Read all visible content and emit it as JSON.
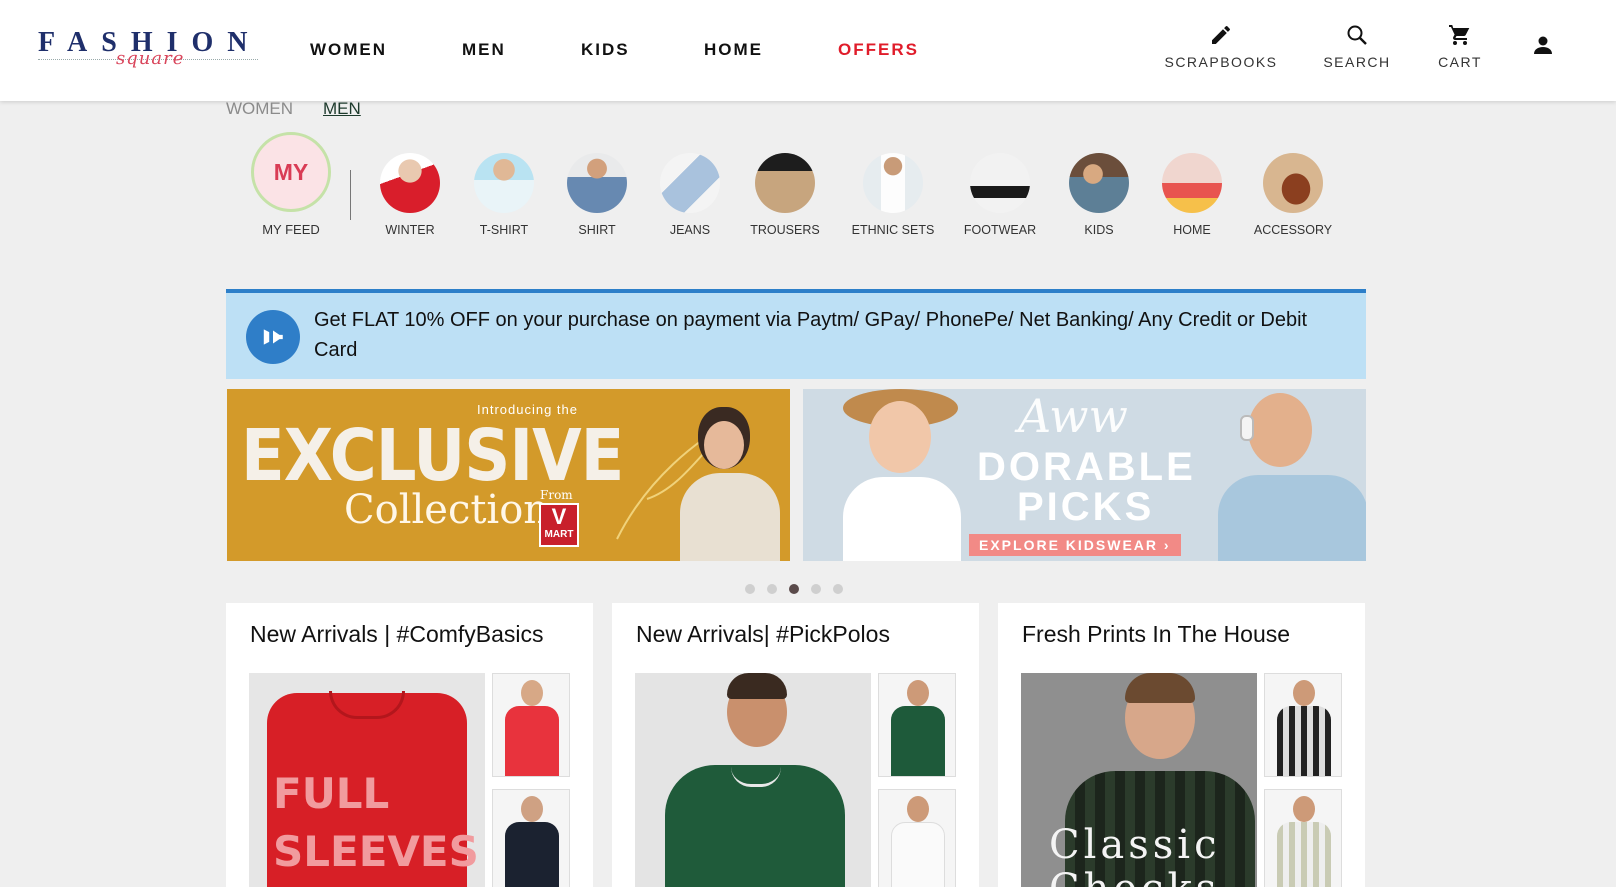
{
  "brand": {
    "name": "FASHION",
    "sub": "square"
  },
  "nav": [
    {
      "label": "WOMEN",
      "highlight": false
    },
    {
      "label": "MEN",
      "highlight": false
    },
    {
      "label": "KIDS",
      "highlight": false
    },
    {
      "label": "HOME",
      "highlight": false
    },
    {
      "label": "OFFERS",
      "highlight": true
    }
  ],
  "header_actions": [
    {
      "label": "SCRAPBOOKS",
      "icon": "pencil-icon"
    },
    {
      "label": "SEARCH",
      "icon": "search-icon"
    },
    {
      "label": "CART",
      "icon": "cart-icon"
    },
    {
      "label": "",
      "icon": "account-icon"
    }
  ],
  "tabs": [
    {
      "label": "WOMEN",
      "active": false
    },
    {
      "label": "MEN",
      "active": true
    }
  ],
  "my_feed": {
    "badge": "MY",
    "label": "MY FEED"
  },
  "categories": [
    {
      "label": "WINTER"
    },
    {
      "label": "T-SHIRT"
    },
    {
      "label": "SHIRT"
    },
    {
      "label": "JEANS"
    },
    {
      "label": "TROUSERS"
    },
    {
      "label": "ETHNIC SETS"
    },
    {
      "label": "FOOTWEAR"
    },
    {
      "label": "KIDS"
    },
    {
      "label": "HOME"
    },
    {
      "label": "ACCESSORY"
    }
  ],
  "offer_banner": {
    "text": "Get FLAT 10% OFF on your purchase on payment via Paytm/ GPay/ PhonePe/ Net Banking/ Any Credit or Debit Card",
    "icon": "megaphone-icon",
    "accent": "#2d7fc9"
  },
  "banners": {
    "left": {
      "intro": "Introducing the",
      "headline": "EXCLUSIVE",
      "collection": "Collection",
      "from": "From",
      "brand_v": "V",
      "brand_mart": "MART"
    },
    "right": {
      "script": "Aww",
      "line1": "DORABLE",
      "line2": "PICKS",
      "cta": "EXPLORE KIDSWEAR ›"
    }
  },
  "carousel": {
    "count": 5,
    "active_index": 2
  },
  "cards": [
    {
      "title": "New Arrivals | #ComfyBasics",
      "main_text_1": "FULL",
      "main_text_2": "SLEEVES"
    },
    {
      "title": "New Arrivals| #PickPolos"
    },
    {
      "title": "Fresh Prints In The House",
      "main_text_1": "Classic",
      "main_text_2": "Checks"
    }
  ]
}
